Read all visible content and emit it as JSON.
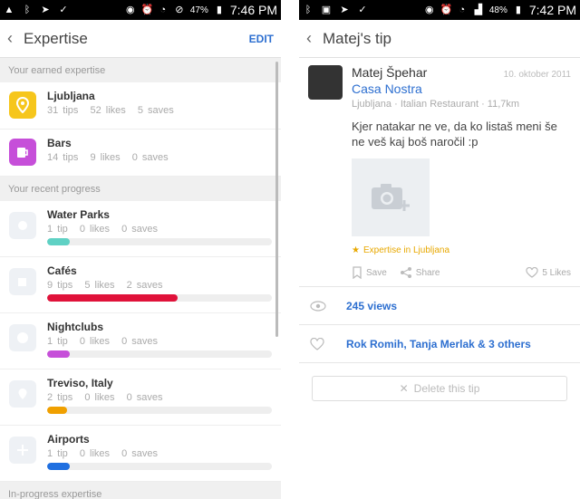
{
  "left": {
    "status": {
      "battery": "47%",
      "time": "7:46 PM"
    },
    "appbar": {
      "title": "Expertise",
      "edit": "EDIT"
    },
    "earned_header": "Your earned expertise",
    "earned": [
      {
        "name": "Ljubljana",
        "tips": "31 tips",
        "likes": "52 likes",
        "saves": "5 saves",
        "icon": "map-pin-icon",
        "color": "#f6c61c"
      },
      {
        "name": "Bars",
        "tips": "14 tips",
        "likes": "9 likes",
        "saves": "0 saves",
        "icon": "beer-mug-icon",
        "color": "#c64fd9"
      }
    ],
    "progress_header": "Your recent progress",
    "progress": [
      {
        "name": "Water Parks",
        "tips": "1 tip",
        "likes": "0 likes",
        "saves": "0 saves",
        "fill": 0.1,
        "color": "#5fd1c4",
        "icon": "water-park-icon"
      },
      {
        "name": "Cafés",
        "tips": "9 tips",
        "likes": "5 likes",
        "saves": "2 saves",
        "fill": 0.58,
        "color": "#e0123a",
        "icon": "cup-icon"
      },
      {
        "name": "Nightclubs",
        "tips": "1 tip",
        "likes": "0 likes",
        "saves": "0 saves",
        "fill": 0.1,
        "color": "#c64fd9",
        "icon": "disco-ball-icon"
      },
      {
        "name": "Treviso, Italy",
        "tips": "2 tips",
        "likes": "0 likes",
        "saves": "0 saves",
        "fill": 0.09,
        "color": "#f0a000",
        "icon": "map-pin-icon"
      },
      {
        "name": "Airports",
        "tips": "1 tip",
        "likes": "0 likes",
        "saves": "0 saves",
        "fill": 0.1,
        "color": "#1f6fe0",
        "icon": "airplane-icon"
      }
    ],
    "inprogress_header": "In-progress expertise"
  },
  "right": {
    "status": {
      "battery": "48%",
      "time": "7:42 PM"
    },
    "appbar": {
      "title": "Matej's tip"
    },
    "author": "Matej Špehar",
    "date": "10. oktober 2011",
    "venue": "Casa Nostra",
    "venue_meta": "Ljubljana · Italian Restaurant · 11,7km",
    "tip_text": "Kjer natakar ne ve, da ko listaš meni še ne veš kaj boš naročil :p",
    "expertise_badge": "Expertise in Ljubljana",
    "save_label": "Save",
    "share_label": "Share",
    "likes_label": "5 Likes",
    "views": "245 views",
    "liked_by": "Rok Romih, Tanja Merlak & 3 others",
    "delete_label": "Delete this tip"
  }
}
